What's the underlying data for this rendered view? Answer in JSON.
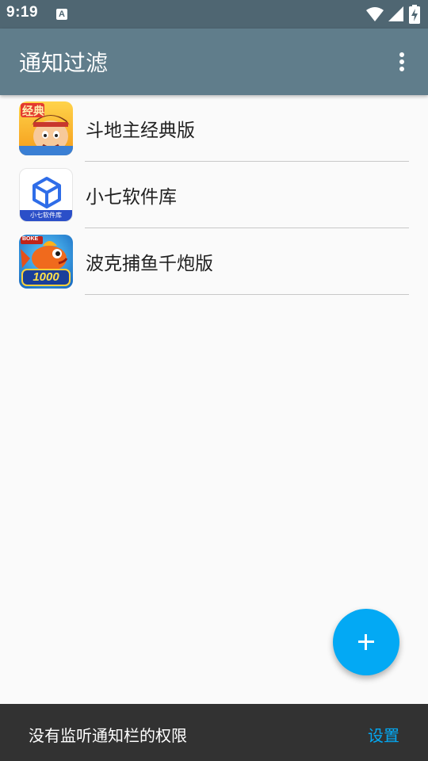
{
  "status_bar": {
    "time": "9:19",
    "notification_icon": "A",
    "icons": [
      "wifi-icon",
      "cell-signal-icon",
      "battery-charging-icon"
    ]
  },
  "app_bar": {
    "title": "通知过滤",
    "menu_icon": "more-vert-icon"
  },
  "apps": [
    {
      "label": "斗地主经典版",
      "icon": "doudizhu-app-icon",
      "icon_text": "经典"
    },
    {
      "label": "小七软件库",
      "icon": "xiaoqi-app-icon",
      "icon_text": "小七软件库"
    },
    {
      "label": "波克捕鱼千炮版",
      "icon": "buyu-app-icon",
      "icon_text": "1000",
      "icon_badge": "BOKE"
    }
  ],
  "fab": {
    "icon": "add-icon"
  },
  "snackbar": {
    "message": "没有监听通知栏的权限",
    "action": "设置"
  },
  "colors": {
    "status_bar": "#4f6672",
    "app_bar": "#607d8b",
    "accent": "#03a9f4",
    "snackbar": "#323232",
    "background": "#fafafa"
  }
}
